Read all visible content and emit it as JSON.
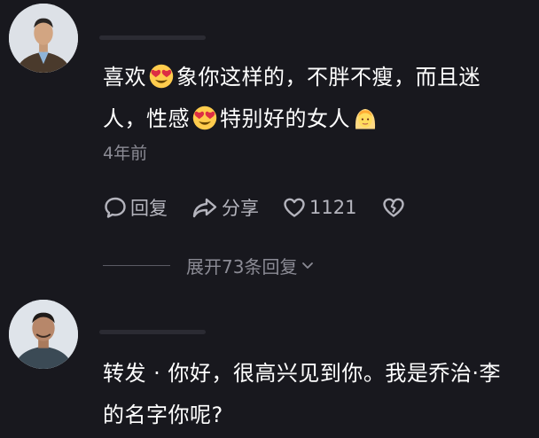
{
  "comments": [
    {
      "text_parts": [
        "喜欢",
        "象你这样的，不胖不瘦，而且迷人，性感",
        "特别好的女人"
      ],
      "emojis": [
        "heart-eyes-emoji",
        "heart-eyes-emoji",
        "blonde-woman-emoji"
      ],
      "timestamp": "4年前",
      "actions": {
        "reply_label": "回复",
        "share_label": "分享",
        "like_count": "1121"
      },
      "more_replies_label": "展开73条回复"
    },
    {
      "text": "转发 · 你好，很高兴见到你。我是乔治·李的名字你呢?"
    }
  ],
  "icons": {
    "reply": "speech-bubble-icon",
    "share": "share-arrow-icon",
    "like": "heart-outline-icon",
    "dislike": "broken-heart-icon",
    "expand": "chevron-down-icon"
  },
  "colors": {
    "background": "#18181e",
    "text": "#ffffff",
    "secondary": "#8b8b95",
    "action": "#b4b4bd"
  }
}
